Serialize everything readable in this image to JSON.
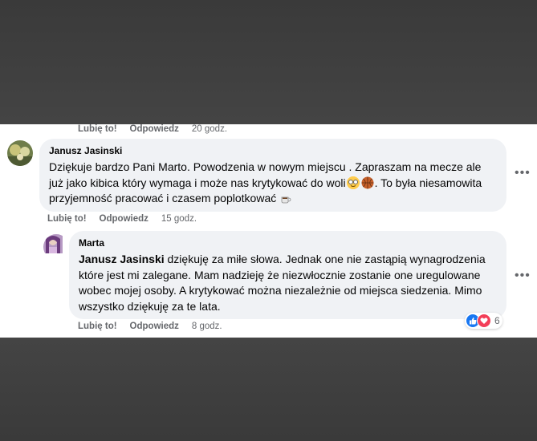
{
  "colors": {
    "bubble": "#f0f2f5",
    "meta_text": "#65676b",
    "like_blue": "#1877f2",
    "heart_red": "#f33e58"
  },
  "top_comment_meta": {
    "like": "Lubię to!",
    "reply": "Odpowiedz",
    "time": "20 godz."
  },
  "comment1": {
    "author": "Janusz Jasinski",
    "text_part1": "Dziękuje bardzo Pani Marto. Powodzenia w nowym miejscu . Zapraszam na mecze ale już jako kibica który wymaga i może nas krytykować do woli",
    "text_part2": ". To była niesamowita przyjemność pracować i czasem poplotkować",
    "emojis": [
      "nerd-face-emoji",
      "basketball-emoji",
      "coffee-emoji"
    ],
    "like": "Lubię to!",
    "reply": "Odpowiedz",
    "time": "15 godz."
  },
  "comment2": {
    "author": "Marta",
    "mention": "Janusz Jasinski",
    "text": " dziękuję za miłe słowa. Jednak one nie zastąpią wynagrodzenia które jest mi zalegane. Mam nadzieję że niezwłocznie zostanie one uregulowane wobec mojej osoby. A krytykować można niezależnie od miejsca siedzenia. Mimo wszystko dziękuję za te lata.",
    "like": "Lubię to!",
    "reply": "Odpowiedz",
    "time": "8 godz.",
    "reactions": [
      "like-icon",
      "love-icon"
    ],
    "reaction_count": "6"
  },
  "more_options": "•••"
}
